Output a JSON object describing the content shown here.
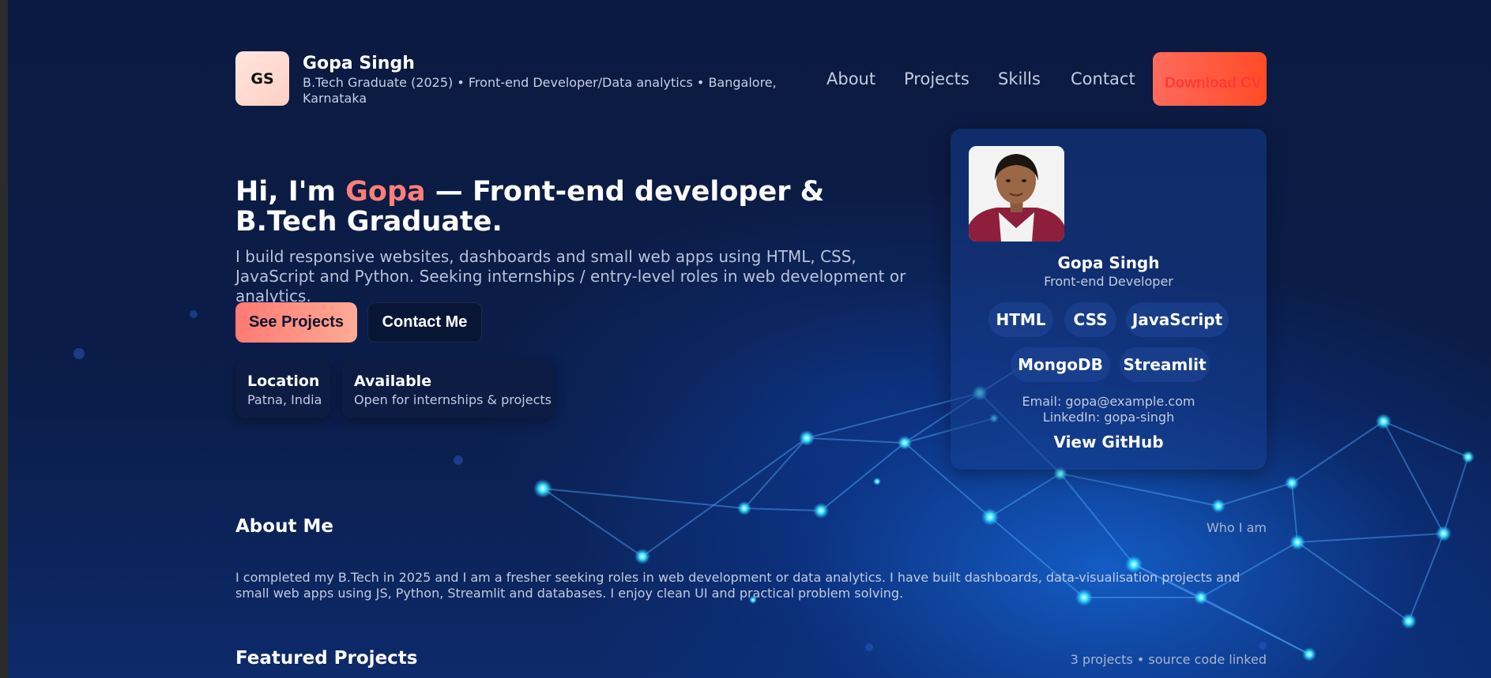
{
  "brand": {
    "initials": "GS",
    "name": "Gopa Singh",
    "subtitle": "B.Tech Graduate (2025) • Front-end Developer/Data analytics • Bangalore, Karnataka"
  },
  "nav": {
    "items": [
      "About",
      "Projects",
      "Skills",
      "Contact"
    ],
    "download_label": "Download CV"
  },
  "hero": {
    "title_prefix": "Hi, I'm ",
    "title_name": "Gopa",
    "title_suffix": " — Front-end developer & B.Tech Graduate.",
    "description": "I build responsive websites, dashboards and small web apps using HTML, CSS, JavaScript and Python. Seeking internships / entry-level roles in web development or analytics.",
    "primary_button": "See Projects",
    "secondary_button": "Contact Me",
    "cards": [
      {
        "title": "Location",
        "subtitle": "Patna, India"
      },
      {
        "title": "Available",
        "subtitle": "Open for internships & projects"
      }
    ]
  },
  "profile": {
    "name": "Gopa Singh",
    "role": "Front-end Developer",
    "skills": [
      "HTML",
      "CSS",
      "JavaScript",
      "MongoDB",
      "Streamlit"
    ],
    "email": "Email: gopa@example.com",
    "linkedin": "LinkedIn: gopa-singh",
    "github_label": "View GitHub"
  },
  "about": {
    "title": "About Me",
    "caption": "Who I am",
    "text": "I completed my B.Tech in 2025 and I am a fresher seeking roles in web development or data analytics. I have built dashboards, data-visualisation projects and small web apps using JS, Python, Streamlit and databases. I enjoy clean UI and practical problem solving."
  },
  "projects": {
    "title": "Featured Projects",
    "caption": "3 projects • source code linked"
  },
  "colors": {
    "background": "#0a1a3f",
    "accent": "#ff7f79",
    "cta": "#ff4b26",
    "network_glow": "#33e0ff"
  }
}
